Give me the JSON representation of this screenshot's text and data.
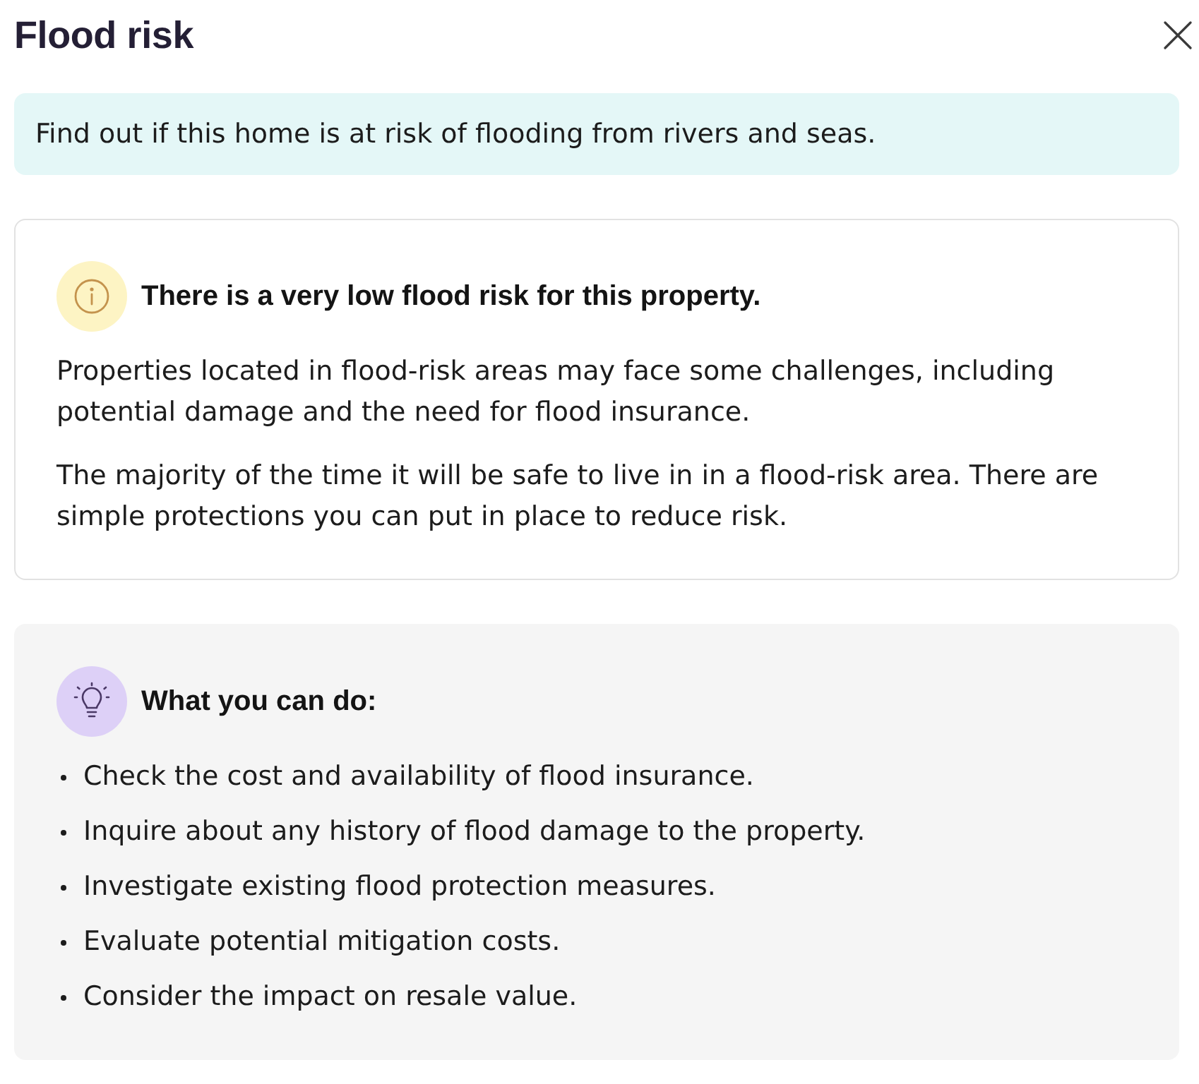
{
  "title": "Flood risk",
  "intro": "Find out if this home is at risk of flooding from rivers and seas.",
  "risk_card": {
    "heading": "There is a very low flood risk for this property.",
    "paragraphs": [
      "Properties located in flood-risk areas may face some challenges, including potential damage and the need for flood insurance.",
      "The majority of the time it will be safe to live in in a flood-risk area. There are simple protections you can put in place to reduce risk."
    ]
  },
  "actions_card": {
    "heading": "What you can do:",
    "items": [
      "Check the cost and availability of flood insurance.",
      "Inquire about any history of flood damage to the property.",
      "Investigate existing flood protection measures.",
      "Evaluate potential mitigation costs.",
      "Consider the impact on resale value."
    ]
  }
}
